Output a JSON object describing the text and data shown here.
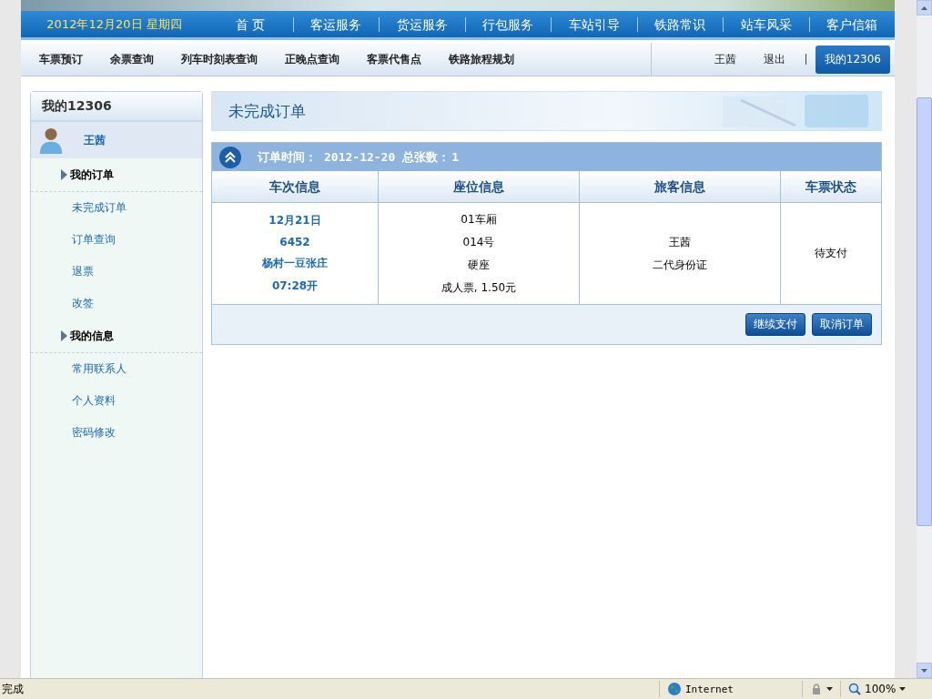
{
  "header": {
    "date": "2012年12月20日  星期四",
    "nav": [
      {
        "label": "首 页"
      },
      {
        "label": "客运服务"
      },
      {
        "label": "货运服务"
      },
      {
        "label": "行包服务"
      },
      {
        "label": "车站引导"
      },
      {
        "label": "铁路常识"
      },
      {
        "label": "站车风采"
      },
      {
        "label": "客户信箱"
      }
    ]
  },
  "subnav": {
    "items": [
      "车票预订",
      "余票查询",
      "列车时刻表查询",
      "正晚点查询",
      "客票代售点",
      "铁路旅程规划"
    ],
    "user": "王茜",
    "logout": "退出",
    "tabs": [
      {
        "label": "我的12306",
        "selected": true
      }
    ]
  },
  "sidebar": {
    "title": "我的12306",
    "user": "王茜",
    "sections": [
      {
        "title": "我的订单",
        "items": [
          "未完成订单",
          "订单查询",
          "退票",
          "改签"
        ]
      },
      {
        "title": "我的信息",
        "items": [
          "常用联系人",
          "个人资料",
          "密码修改"
        ]
      }
    ]
  },
  "main": {
    "title": "未完成订单",
    "order_header": {
      "time_label": "订单时间：",
      "time": "2012-12-20",
      "count_label": "总张数：",
      "count": "1"
    },
    "columns": [
      "车次信息",
      "座位信息",
      "旅客信息",
      "车票状态"
    ],
    "row": {
      "train": [
        "12月21日",
        "6452",
        "杨村一豆张庄",
        "07:28开"
      ],
      "seat": [
        "01车厢",
        "014号",
        "硬座",
        "成人票, 1.50元"
      ],
      "passenger": [
        "王茜",
        "二代身份证"
      ],
      "status": "待支付"
    },
    "buttons": [
      "继续支付",
      "取消订单"
    ]
  },
  "status_bar": {
    "text": "完成",
    "zone": "Internet",
    "zoom": "100%"
  }
}
